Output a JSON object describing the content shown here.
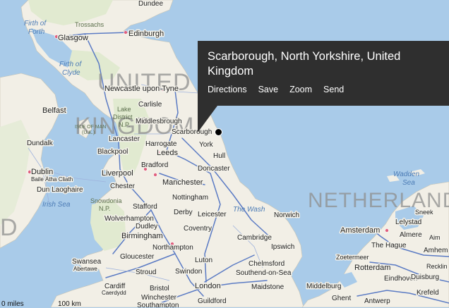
{
  "popup": {
    "title": "Scarborough, North Yorkshire, United Kingdom",
    "actions": {
      "directions": "Directions",
      "save": "Save",
      "zoom": "Zoom",
      "send": "Send"
    }
  },
  "countries": {
    "uk_line1": "UNITED",
    "uk_line2": "KINGDOM",
    "netherlands": "NETHERLANDS"
  },
  "seas": {
    "firth_of_forth_1": "Firth of",
    "firth_of_forth_2": "Forth",
    "firth_of_clyde_1": "Firth of",
    "firth_of_clyde_2": "Clyde",
    "irish_sea": "Irish Sea",
    "the_wash": "The Wash",
    "wadden_1": "Wadden",
    "wadden_2": "Sea"
  },
  "parks": {
    "trossachs": "Trossachs",
    "lake_district_1": "Lake",
    "lake_district_2": "District",
    "lake_district_3": "N.P.",
    "isle_of_man_1": "ISLE OF MAN",
    "isle_of_man_2": "(U.K.)",
    "snowdonia_1": "Snowdonia",
    "snowdonia_2": "N.P."
  },
  "places": {
    "dundee": "Dundee",
    "glasgow": "Glasgow",
    "edinburgh": "Edinburgh",
    "newcastle": "Newcastle upon Tyne",
    "belfast": "Belfast",
    "carlisle": "Carlisle",
    "middlesbrough": "Middlesbrough",
    "scarborough": "Scarborough",
    "lancaster": "Lancaster",
    "harrogate": "Harrogate",
    "dundalk": "Dundalk",
    "blackpool": "Blackpool",
    "leeds": "Leeds",
    "york": "York",
    "hull": "Hull",
    "bradford": "Bradford",
    "doncaster": "Doncaster",
    "dublin": "Dublin",
    "baile_atha_cliath": "Baile Átha Cliath",
    "liverpool": "Liverpool",
    "manchester": "Manchester",
    "dun_laoghaire": "Dun Laoghaire",
    "chester": "Chester",
    "nottingham": "Nottingham",
    "stafford": "Stafford",
    "derby": "Derby",
    "leicester": "Leicester",
    "norwich": "Norwich",
    "wolverhampton": "Wolverhampton",
    "dudley": "Dudley",
    "coventry": "Coventry",
    "birmingham": "Birmingham",
    "cambridge": "Cambridge",
    "ipswich": "Ipswich",
    "northampton": "Northampton",
    "gloucester": "Gloucester",
    "swansea": "Swansea",
    "abertawe": "Abertawe",
    "luton": "Luton",
    "chelmsford": "Chelmsford",
    "stroud": "Stroud",
    "swindon": "Swindon",
    "southend": "Southend-on-Sea",
    "cardiff": "Cardiff",
    "caerdydd": "Caerdydd",
    "bristol": "Bristol",
    "london": "London",
    "maidstone": "Maidstone",
    "middelburg": "Middelburg",
    "ghent": "Ghent",
    "antwerp": "Antwerp",
    "winchester": "Winchester",
    "guildford": "Guildford",
    "southampton": "Southampton",
    "amsterdam": "Amsterdam",
    "lelystad": "Lelystad",
    "almere": "Almere",
    "the_hague": "The Hague",
    "zoetermeer": "Zoetermeer",
    "rotterdam": "Rotterdam",
    "eindhoven": "Eindhoven",
    "duisburg": "Duisburg",
    "krefeld": "Krefeld",
    "amhem": "Amhem",
    "sneek": "Sneek",
    "aim": "Aim",
    "recklinghausen": "Recklin"
  },
  "scale": {
    "miles": "0 miles",
    "km": "100 km"
  },
  "colors": {
    "sea": "#a9cbe9",
    "land": "#f2efe6",
    "green_land": "#e2ead1",
    "motorway": "#5b7bc4",
    "popup_bg": "#2f2f2f"
  }
}
